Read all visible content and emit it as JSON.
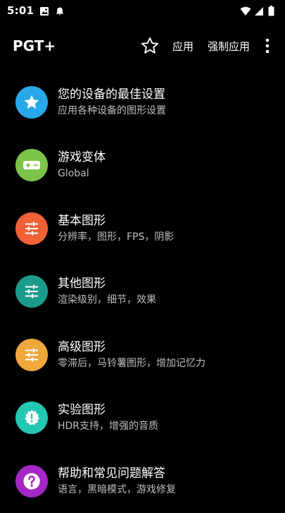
{
  "status_bar": {
    "time": "5:01",
    "left_icons": [
      "image-icon",
      "notification-icon"
    ],
    "right_icons": [
      "wifi-icon",
      "signal-icon",
      "battery-icon"
    ]
  },
  "app_bar": {
    "title": "PGT+",
    "favorite_icon": "star-outline-icon",
    "apply_label": "应用",
    "force_apply_label": "强制应用",
    "more_icon": "more-vert-icon"
  },
  "menu": {
    "items": [
      {
        "title": "您的设备的最佳设置",
        "subtitle": "应用各种设备的图形设置",
        "icon": "star-icon",
        "color": "#29a8e9"
      },
      {
        "title": "游戏变体",
        "subtitle": "Global",
        "icon": "gamepad-icon",
        "color": "#7dc34a"
      },
      {
        "title": "基本图形",
        "subtitle": "分辨率，图形，FPS，阴影",
        "icon": "sliders-icon",
        "color": "#f06236"
      },
      {
        "title": "其他图形",
        "subtitle": "渲染级别，细节，效果",
        "icon": "sliders-icon",
        "color": "#1b9b8c"
      },
      {
        "title": "高级图形",
        "subtitle": "零滞后，马铃薯图形，增加记忆力",
        "icon": "sliders-icon",
        "color": "#f0a83c"
      },
      {
        "title": "实验图形",
        "subtitle": "HDR支持，增强的音质",
        "icon": "warning-badge-icon",
        "color": "#23c8b3"
      },
      {
        "title": "帮助和常见问题解答",
        "subtitle": "语言，黑暗模式，游戏修复",
        "icon": "help-icon",
        "color": "#a428c6"
      }
    ]
  }
}
